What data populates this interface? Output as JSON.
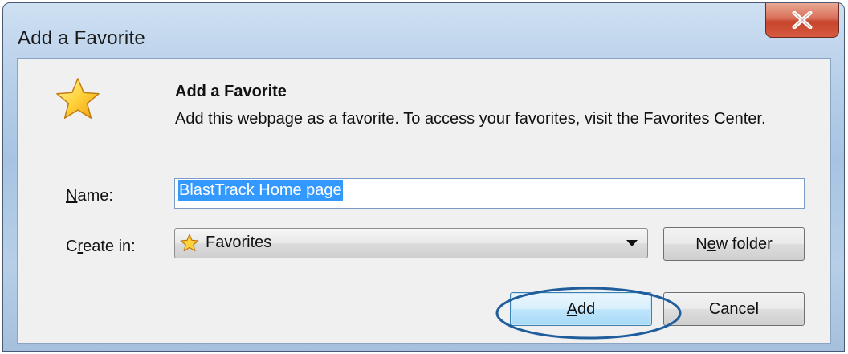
{
  "window": {
    "title": "Add a Favorite",
    "close_label": "X"
  },
  "header": {
    "icon": "star-icon",
    "heading": "Add a Favorite",
    "description": "Add this webpage as a favorite. To access your favorites, visit the Favorites Center."
  },
  "form": {
    "name_label_prefix": "",
    "name_label_accel": "N",
    "name_label_rest": "ame:",
    "name_value": "BlastTrack Home page",
    "createin_label_prefix": "C",
    "createin_label_accel": "r",
    "createin_label_rest": "eate in:",
    "createin_value": "Favorites",
    "newfolder_prefix": "N",
    "newfolder_accel": "e",
    "newfolder_rest": "w folder"
  },
  "buttons": {
    "add_accel": "A",
    "add_rest": "dd",
    "cancel_label": "Cancel"
  },
  "colors": {
    "selection": "#3399ff",
    "highlight_ellipse": "#1f5d9c"
  }
}
